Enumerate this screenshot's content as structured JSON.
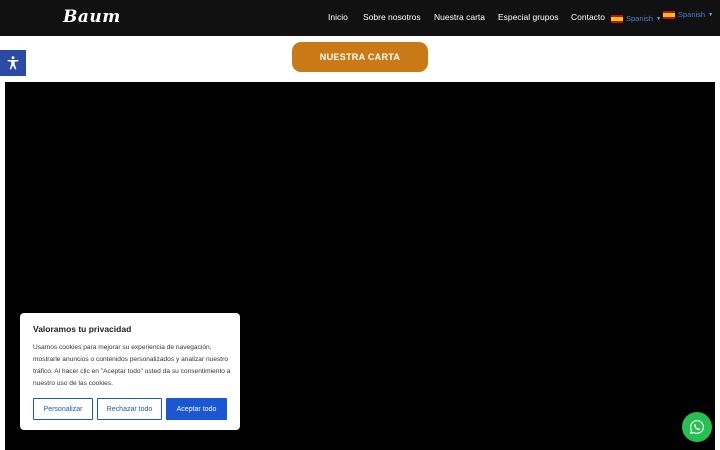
{
  "header": {
    "logo": "Baum",
    "nav": [
      {
        "label": "Inicio"
      },
      {
        "label": "Sobre nosotros"
      },
      {
        "label": "Nuestra carta"
      },
      {
        "label": "Especial grupos"
      },
      {
        "label": "Contacto"
      }
    ],
    "language_selectors": [
      {
        "label": "Spanish",
        "icon": "spain-flag-icon"
      },
      {
        "label": "Spanish",
        "icon": "spain-flag-icon"
      }
    ]
  },
  "accessibility": {
    "icon": "accessibility-person-icon"
  },
  "main": {
    "carta_button": "NUESTRA CARTA"
  },
  "cookie_banner": {
    "title": "Valoramos tu privacidad",
    "text": "Usamos cookies para mejorar su experiencia de navegación, mostrarle anuncios o contenidos personalizados y analizar nuestro tráfico. Al hacer clic en \"Aceptar todo\" usted da su consentimiento a nuestro uso de las cookies.",
    "buttons": {
      "customize": "Personalizar",
      "reject": "Rechazar todo",
      "accept": "Aceptar todo"
    }
  },
  "whatsapp": {
    "icon": "whatsapp-icon"
  },
  "colors": {
    "header_bg": "#111111",
    "carta_button": "#c97a16",
    "cookie_accent": "#1a57d1",
    "accessibility_bg": "#2b4aa6",
    "whatsapp_bg": "#25c050"
  }
}
